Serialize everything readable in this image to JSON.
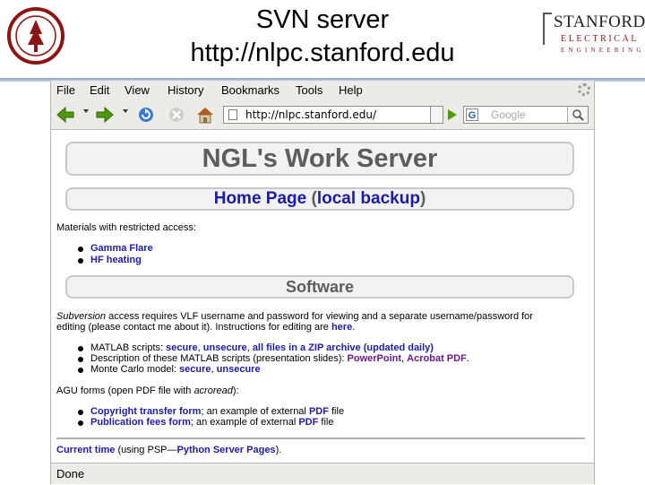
{
  "slide": {
    "title_line1": "SVN server",
    "title_line2": "http://nlpc.stanford.edu",
    "logo_stanford": "STANFORD",
    "logo_electrical": "ELECTRICAL",
    "logo_engineering": "ENGINEERING"
  },
  "browser": {
    "menu": [
      "File",
      "Edit",
      "View",
      "History",
      "Bookmarks",
      "Tools",
      "Help"
    ],
    "url": "http://nlpc.stanford.edu/",
    "search_placeholder": "Google",
    "status": "Done"
  },
  "page": {
    "header": "NGL's Work Server",
    "home_link": "Home Page",
    "home_paren_open": " (",
    "local_backup": "local backup",
    "home_paren_close": ")",
    "restricted": "Materials with restricted access:",
    "restricted_items": [
      "Gamma Flare",
      "HF heating"
    ],
    "software_header": "Software",
    "svn_em": "Subversion",
    "svn_text1": " access requires VLF username and password for viewing and a separate username/password for",
    "svn_text2": "editing (please contact me about it). Instructions for editing are ",
    "svn_here": "here",
    "svn_dot": ".",
    "matlab_label": "MATLAB scripts: ",
    "matlab_secure": "secure",
    "matlab_sep1": ", ",
    "matlab_unsecure": "unsecure",
    "matlab_sep2": ", ",
    "matlab_zip": "all files in a ZIP archive (updated daily)",
    "desc_label": "Description of these MATLAB scripts (presentation slides): ",
    "desc_ppt": "PowerPoint",
    "desc_sep": ", ",
    "desc_pdf": "Acrobat PDF",
    "desc_dot": ".",
    "mc_label": "Monte Carlo model: ",
    "mc_secure": "secure",
    "mc_sep": ", ",
    "mc_unsecure": "unsecure",
    "agu_text1": "AGU forms (open PDF file with ",
    "agu_em": "acroread",
    "agu_text2": "):",
    "copyright_link": "Copyright transfer form",
    "copyright_text": "; an example of external ",
    "copyright_pdf": "PDF",
    "copyright_file": " file",
    "pubfee_link": "Publication fees form",
    "pubfee_text": "; an example of external ",
    "pubfee_pdf": "PDF",
    "pubfee_file": " file",
    "time_link": "Current time",
    "time_text1": " (using PSP—",
    "time_psp": "Python Server Pages",
    "time_text2": ")."
  },
  "colors": {
    "link": "#1c1ca8",
    "visited": "#6a1a8a",
    "header_gray": "#5d5d60",
    "cardinal": "#8c1515"
  }
}
